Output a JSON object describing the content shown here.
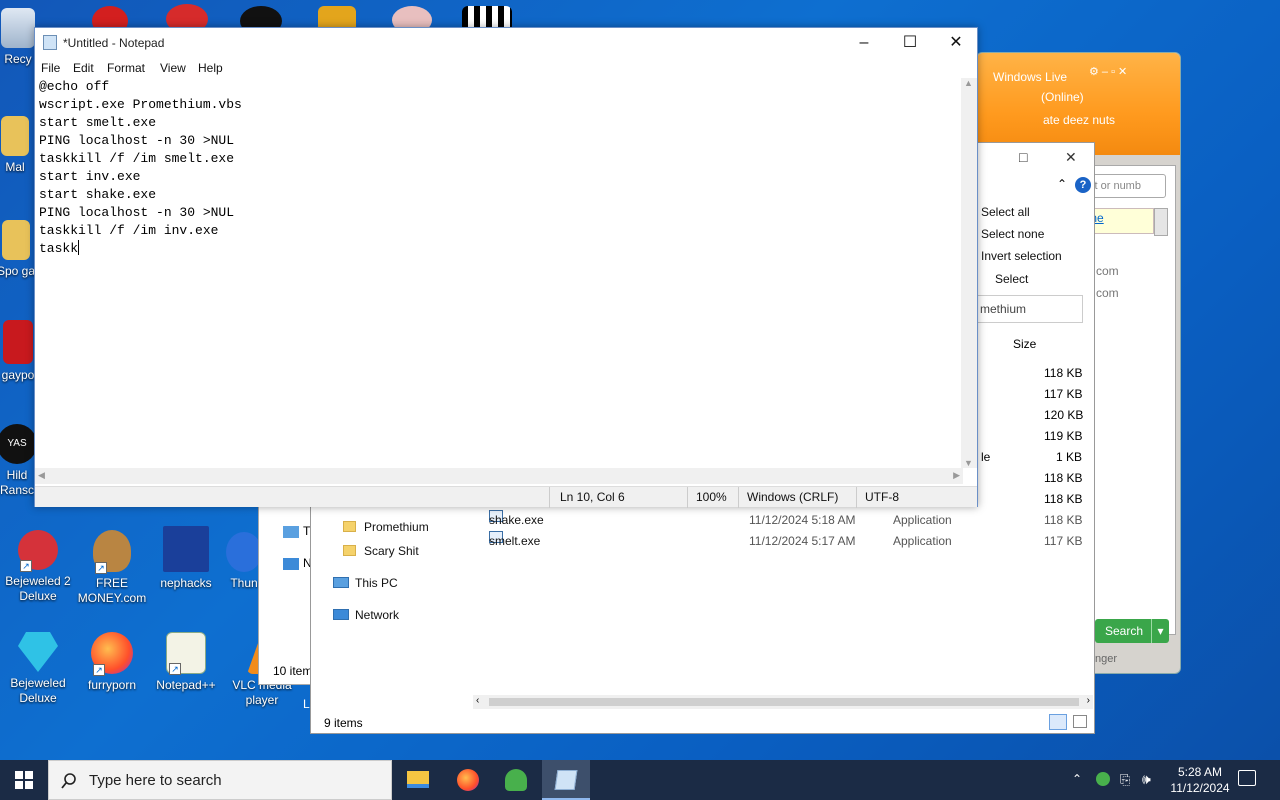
{
  "desktop": {
    "icons": [
      {
        "label": "Recy"
      },
      {
        "label": "Mal"
      },
      {
        "label": "Spo ga"
      },
      {
        "label": "gaypo"
      },
      {
        "label": "Hild Ransc"
      },
      {
        "label": "Bejeweled 2 Deluxe"
      },
      {
        "label": "FREE MONEY.com"
      },
      {
        "label": "nephacks"
      },
      {
        "label": "Thun"
      },
      {
        "label": "Bejeweled Deluxe"
      },
      {
        "label": "furryporn"
      },
      {
        "label": "Notepad++"
      },
      {
        "label": "VLC media player"
      }
    ],
    "badge_yas": "YAS"
  },
  "msn": {
    "title": "Windows Live",
    "status": "(Online)",
    "personal_message": "ate deez nuts",
    "search_placeholder": "ct or numb",
    "link_text": "the",
    "contact_a": "com",
    "contact_b": "com",
    "search_button": "Search",
    "footer": "nger"
  },
  "explorer": {
    "ribbon": [
      "Select all",
      "Select none",
      "Invert selection"
    ],
    "ribbon_group": "Select",
    "search_value": "methium",
    "column_size": "Size",
    "sizes": [
      "118 KB",
      "117 KB",
      "120 KB",
      "119 KB",
      "1 KB",
      "118 KB",
      "118 KB"
    ],
    "partial_type": "le",
    "nav": [
      {
        "label": "Promethium"
      },
      {
        "label": "Scary Shit"
      },
      {
        "label": "This PC"
      },
      {
        "label": "Network"
      }
    ],
    "files": [
      {
        "name": "shake.exe",
        "date": "11/12/2024 5:18 AM",
        "type": "Application",
        "size": "118 KB"
      },
      {
        "name": "smelt.exe",
        "date": "11/12/2024 5:17 AM",
        "type": "Application",
        "size": "117 KB"
      }
    ],
    "status": "9 items",
    "back_status": "10 item",
    "back_letters": [
      "T",
      "N",
      "L"
    ]
  },
  "notepad": {
    "title": "*Untitled - Notepad",
    "menu": [
      "File",
      "Edit",
      "Format",
      "View",
      "Help"
    ],
    "lines": [
      "@echo off",
      "wscript.exe Promethium.vbs",
      "start smelt.exe",
      "PING localhost -n 30 >NUL",
      "taskkill /f /im smelt.exe",
      "start inv.exe",
      "start shake.exe",
      "PING localhost -n 30 >NUL",
      "taskkill /f /im inv.exe",
      "taskk"
    ],
    "status": {
      "position": "Ln 10, Col 6",
      "zoom": "100%",
      "eol": "Windows (CRLF)",
      "encoding": "UTF-8"
    }
  },
  "taskbar": {
    "search_placeholder": "Type here to search",
    "time": "5:28 AM",
    "date": "11/12/2024"
  },
  "colors": {
    "accent": "#0e6fd0",
    "taskbar": "#1b2b45",
    "msn_orange": "#ff9a1e",
    "msn_green": "#3aa64a"
  }
}
